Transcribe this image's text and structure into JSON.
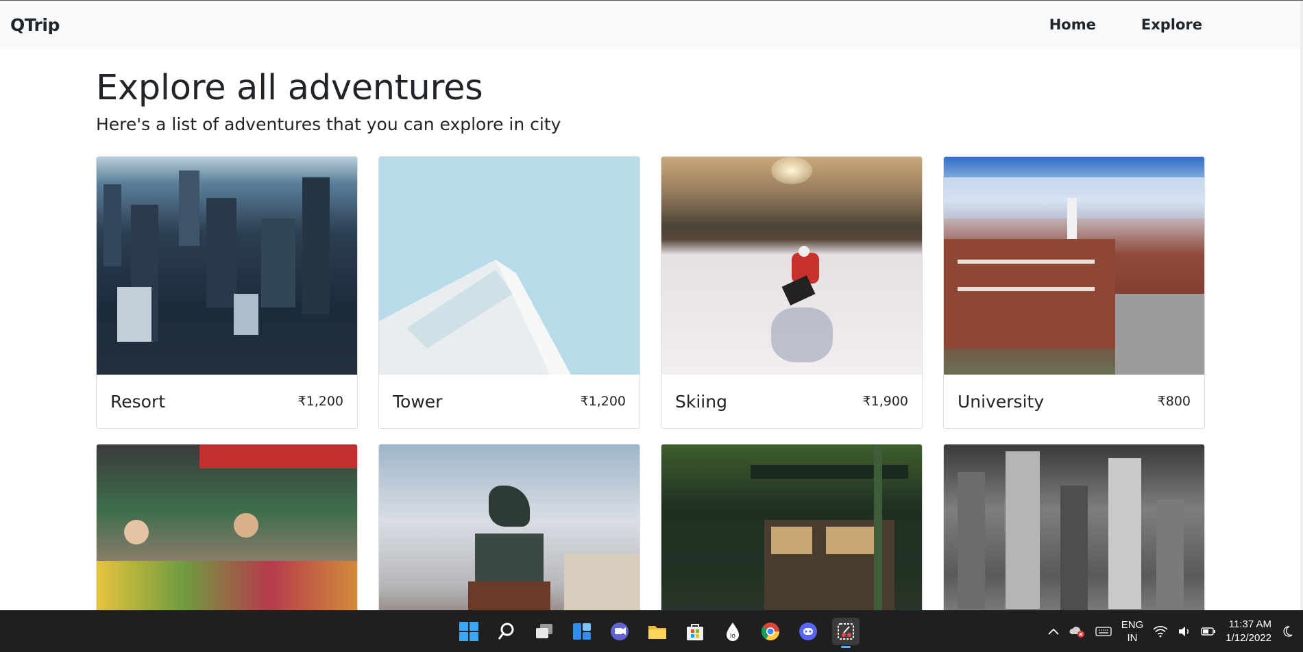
{
  "navbar": {
    "brand": "QTrip",
    "links": [
      {
        "label": "Home"
      },
      {
        "label": "Explore"
      }
    ]
  },
  "header": {
    "title": "Explore all adventures",
    "subtitle": "Here's a list of adventures that you can explore in city"
  },
  "adventures": [
    {
      "name": "Resort",
      "price": "₹1,200",
      "image": "city-skyline-night"
    },
    {
      "name": "Tower",
      "price": "₹1,200",
      "image": "white-building-sky"
    },
    {
      "name": "Skiing",
      "price": "₹1,900",
      "image": "skier-snow-slope"
    },
    {
      "name": "University",
      "price": "₹800",
      "image": "brick-campus-buildings"
    },
    {
      "name": "",
      "price": "",
      "image": "street-market-vegetables"
    },
    {
      "name": "",
      "price": "",
      "image": "equestrian-statue"
    },
    {
      "name": "",
      "price": "",
      "image": "bakery-storefront"
    },
    {
      "name": "",
      "price": "",
      "image": "city-skyline-grayscale"
    }
  ],
  "taskbar": {
    "apps": [
      "windows-start-icon",
      "search-icon",
      "task-view-icon",
      "widgets-icon",
      "teams-chat-icon",
      "file-explorer-icon",
      "microsoft-store-icon",
      "io-app-icon",
      "chrome-icon",
      "discord-icon",
      "snipping-tool-icon"
    ],
    "language": {
      "line1": "ENG",
      "line2": "IN"
    },
    "time": "11:37 AM",
    "date": "1/12/2022"
  },
  "colors": {
    "navbar_bg": "#f8f9fa",
    "taskbar_bg": "#1f1f1f",
    "accent": "#5ab0ff"
  }
}
